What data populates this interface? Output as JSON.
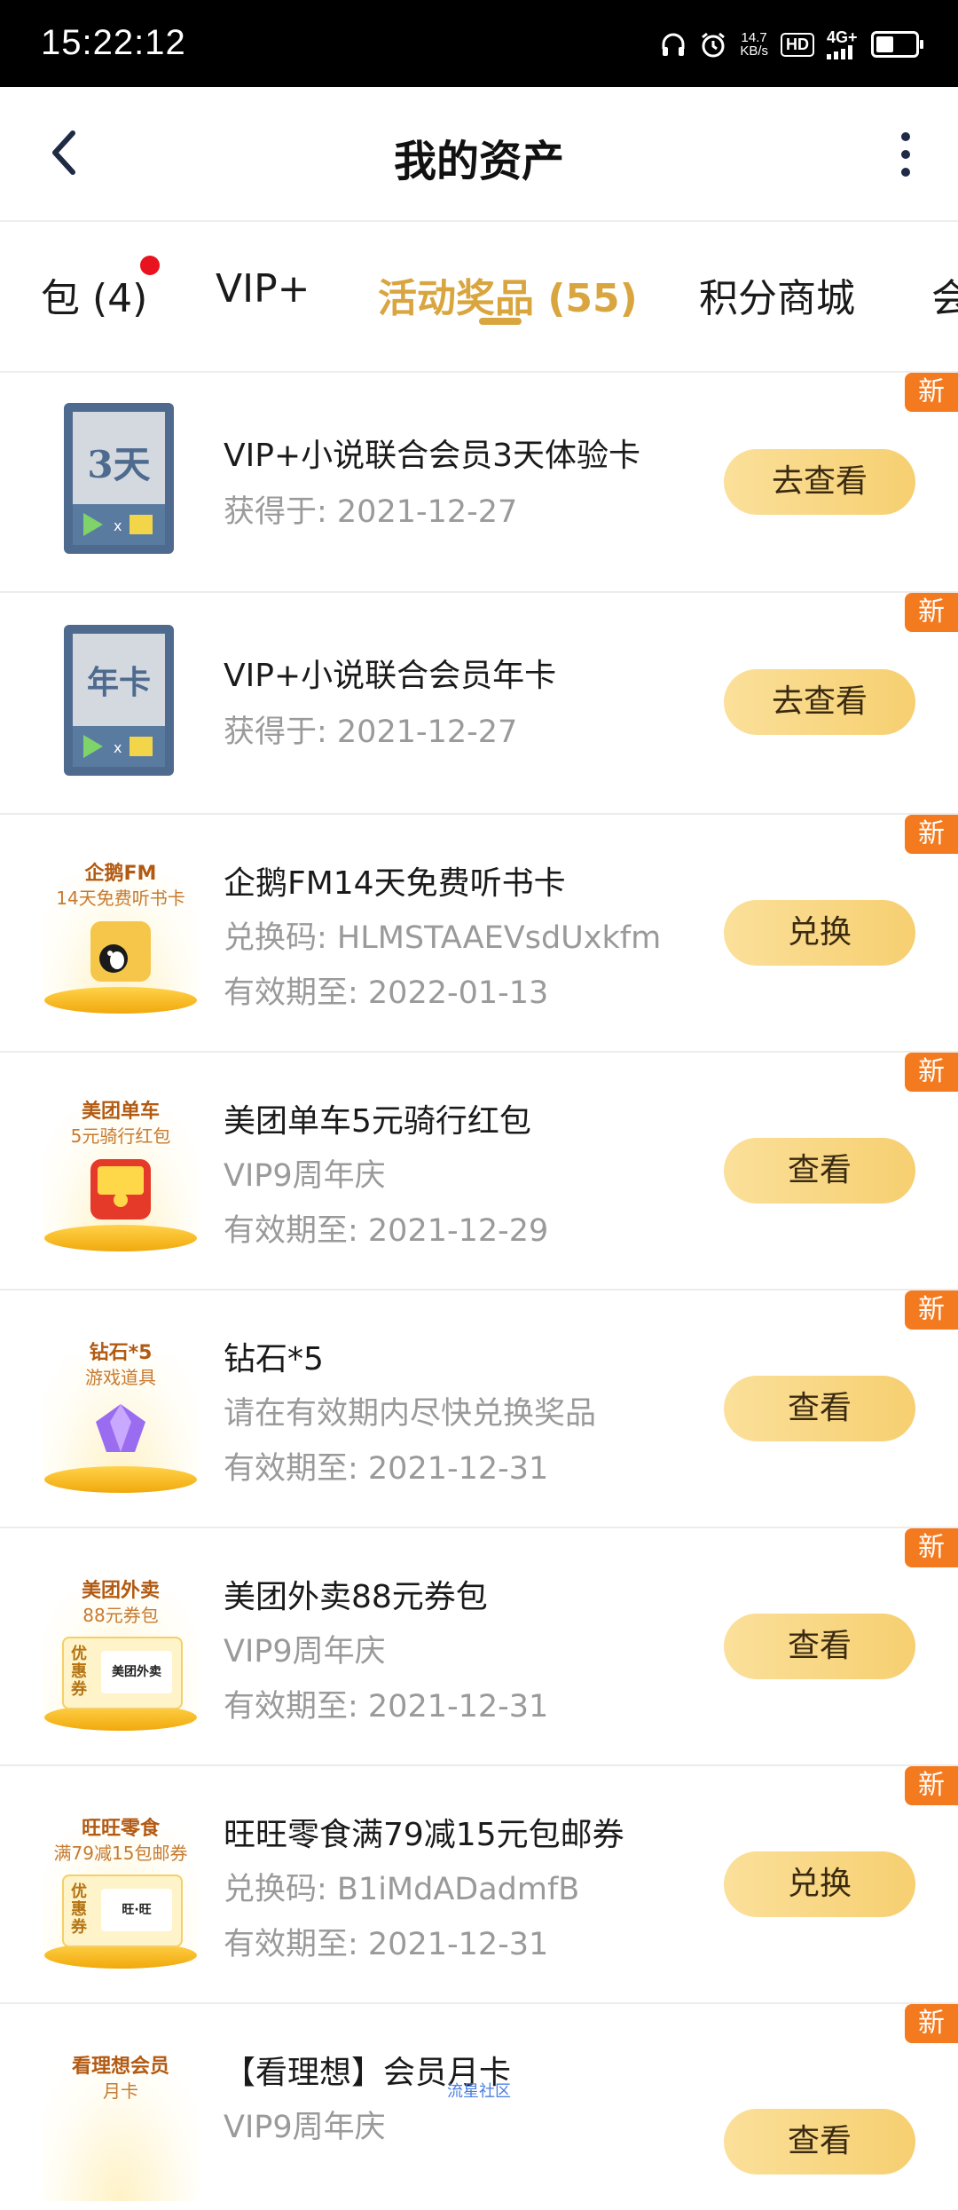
{
  "status": {
    "time": "15:22:12",
    "net_speed_value": "14.7",
    "net_speed_unit": "KB/s",
    "hd": "HD",
    "signal": "4G+"
  },
  "header": {
    "title": "我的资产"
  },
  "tabs": [
    {
      "label": "包 (4)",
      "has_dot": true
    },
    {
      "label": "VIP+"
    },
    {
      "label": "活动奖品 (55)",
      "active": true
    },
    {
      "label": "积分商城"
    },
    {
      "label": "会"
    }
  ],
  "badge_label": "新",
  "items": [
    {
      "thumb": "3天",
      "thumb_type": "card",
      "name": "VIP+小说联合会员3天体验卡",
      "lines": [
        "获得于: 2021-12-27"
      ],
      "button": "去查看"
    },
    {
      "thumb": "年卡",
      "thumb_type": "card",
      "name": "VIP+小说联合会员年卡",
      "lines": [
        "获得于: 2021-12-27"
      ],
      "button": "去查看"
    },
    {
      "thumb_title": "企鹅FM",
      "thumb_sub": "14天免费听书卡",
      "thumb_type": "gift",
      "name": "企鹅FM14天免费听书卡",
      "lines": [
        "兑换码: HLMSTAAEVsdUxkfm",
        "有效期至: 2022-01-13"
      ],
      "button": "兑换"
    },
    {
      "thumb_title": "美团单车",
      "thumb_sub": "5元骑行红包",
      "thumb_type": "gift",
      "name": "美团单车5元骑行红包",
      "lines": [
        "VIP9周年庆",
        "有效期至: 2021-12-29"
      ],
      "button": "查看"
    },
    {
      "thumb_title": "钻石*5",
      "thumb_sub": "游戏道具",
      "thumb_type": "gift",
      "name": "钻石*5",
      "lines": [
        "请在有效期内尽快兑换奖品",
        "有效期至: 2021-12-31"
      ],
      "button": "查看"
    },
    {
      "thumb_title": "美团外卖",
      "thumb_sub": "88元券包",
      "thumb_type": "coupon",
      "coupon_logo": "美团外卖",
      "name": "美团外卖88元券包",
      "lines": [
        "VIP9周年庆",
        "有效期至: 2021-12-31"
      ],
      "button": "查看"
    },
    {
      "thumb_title": "旺旺零食",
      "thumb_sub": "满79减15包邮券",
      "thumb_type": "coupon",
      "coupon_logo": "旺·旺",
      "name": "旺旺零食满79减15元包邮券",
      "lines": [
        "兑换码: B1iMdADadmfB",
        "有效期至: 2021-12-31"
      ],
      "button": "兑换"
    },
    {
      "thumb_title": "看理想会员",
      "thumb_sub": "月卡",
      "thumb_type": "gift",
      "name": "【看理想】会员月卡",
      "lines": [
        "VIP9周年庆"
      ],
      "button": "查看"
    }
  ],
  "coupon_label": "优惠券",
  "watermark": "流星社区"
}
